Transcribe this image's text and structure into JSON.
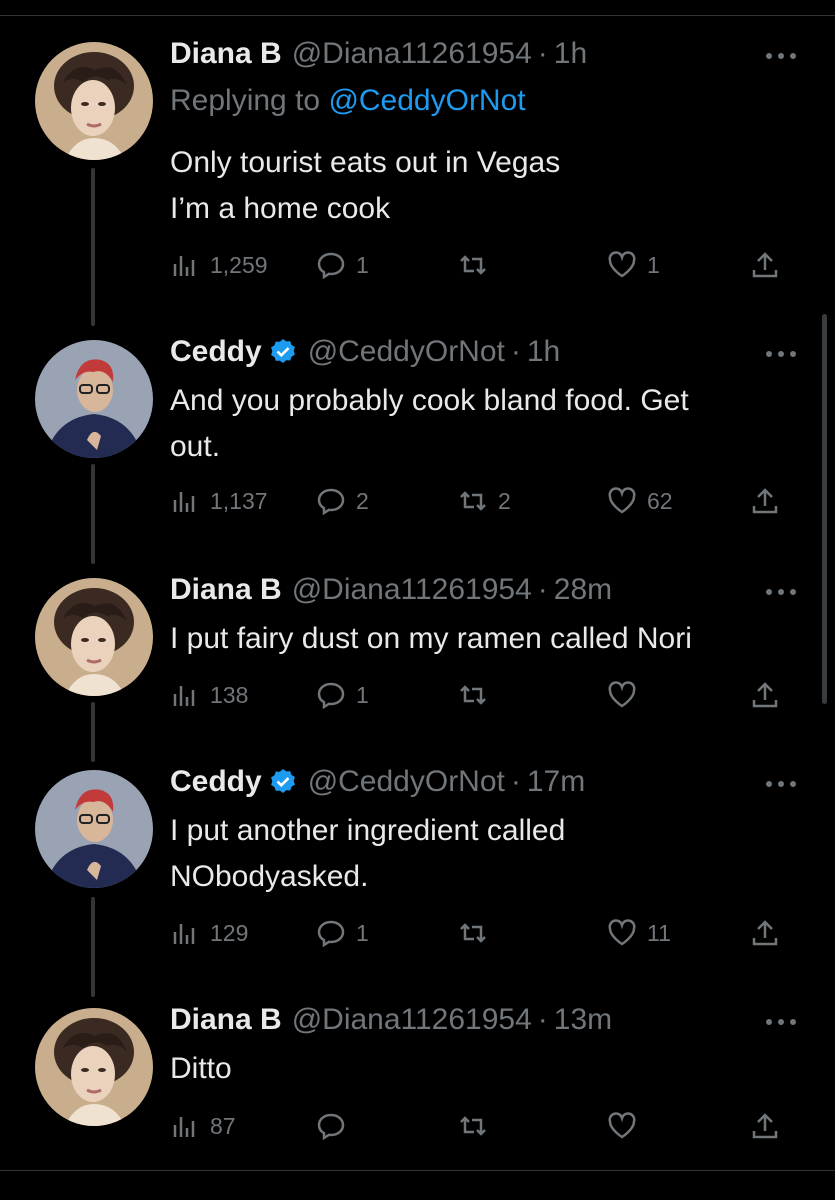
{
  "tweets": [
    {
      "name": "Diana B",
      "handle": "@Diana11261954",
      "dot": "·",
      "time": "1h",
      "replying_prefix": "Replying to ",
      "replying_to": "@CeddyOrNot",
      "text": "Only tourist eats out in Vegas\nI’m a home cook",
      "views": "1,259",
      "replies": "1",
      "retweets": "",
      "likes": "1",
      "avatar": "diana-avatar"
    },
    {
      "name": "Ceddy",
      "handle": "@CeddyOrNot",
      "dot": "·",
      "time": "1h",
      "text": "And you probably cook bland food. Get\nout.",
      "views": "1,137",
      "replies": "2",
      "retweets": "2",
      "likes": "62",
      "avatar": "ceddy-avatar"
    },
    {
      "name": "Diana B",
      "handle": "@Diana11261954",
      "dot": "·",
      "time": "28m",
      "text": "I put fairy dust on my ramen called Nori",
      "views": "138",
      "replies": "1",
      "retweets": "",
      "likes": "",
      "avatar": "diana-avatar"
    },
    {
      "name": "Ceddy",
      "handle": "@CeddyOrNot",
      "dot": "·",
      "time": "17m",
      "text": "I put another ingredient called\nNObodyasked.",
      "views": "129",
      "replies": "1",
      "retweets": "",
      "likes": "11",
      "avatar": "ceddy-avatar"
    },
    {
      "name": "Diana B",
      "handle": "@Diana11261954",
      "dot": "·",
      "time": "13m",
      "text": "Ditto",
      "views": "87",
      "replies": "",
      "retweets": "",
      "likes": "",
      "avatar": "diana-avatar"
    }
  ],
  "colors": {
    "background": "#000000",
    "text": "#e7e9ea",
    "secondary": "#71767b",
    "accent": "#1d9bf0",
    "verified": "#1d9bf0"
  },
  "icons": [
    "views-icon",
    "reply-icon",
    "retweet-icon",
    "like-icon",
    "share-icon",
    "more-icon",
    "verified-badge-icon"
  ]
}
